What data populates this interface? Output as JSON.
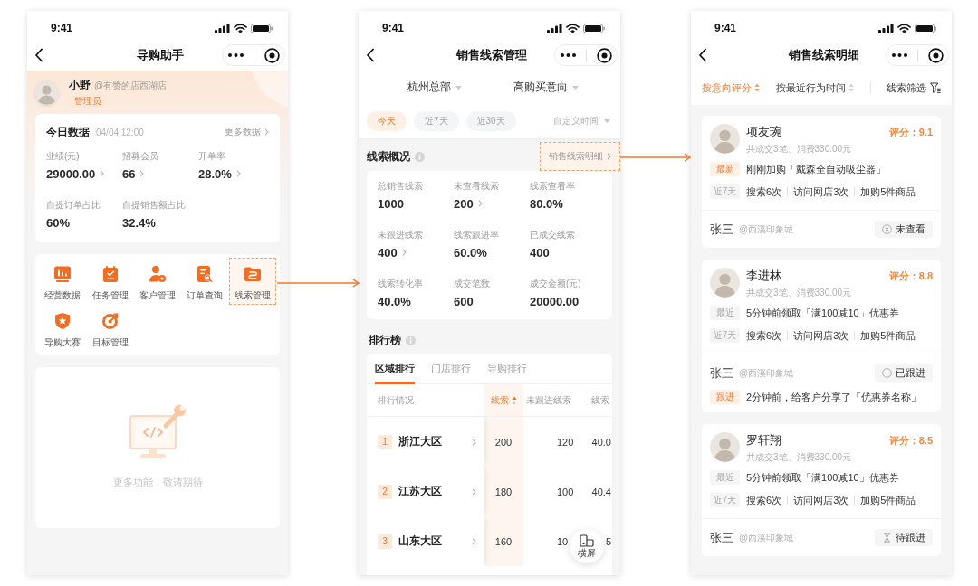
{
  "home_screen": {
    "status_time": "9:41",
    "title": "导购助手",
    "profile": {
      "name": "小野",
      "store": "@有赞的店西湖店",
      "role": "管理员"
    },
    "today": {
      "title": "今日数据",
      "time": "04/04 12:00",
      "more": "更多数据",
      "metrics": [
        {
          "label": "业绩(元)",
          "value": "29000.00",
          "link": true
        },
        {
          "label": "招募会员",
          "value": "66",
          "link": true
        },
        {
          "label": "开单率",
          "value": "28.0%",
          "link": true
        },
        {
          "label": "自提订单占比",
          "value": "60%",
          "link": false
        },
        {
          "label": "自提销售额占比",
          "value": "32.4%",
          "link": false
        }
      ]
    },
    "menu": [
      {
        "label": "经营数据",
        "highlighted": false
      },
      {
        "label": "任务管理",
        "highlighted": false
      },
      {
        "label": "客户管理",
        "highlighted": false
      },
      {
        "label": "订单查询",
        "highlighted": false
      },
      {
        "label": "线索管理",
        "highlighted": true
      },
      {
        "label": "导购大赛",
        "highlighted": false
      },
      {
        "label": "目标管理",
        "highlighted": false
      }
    ],
    "empty_state": {
      "text": "更多功能，敬请期待"
    }
  },
  "leads_screen": {
    "status_time": "9:41",
    "title": "销售线索管理",
    "dropdowns": [
      "杭州总部",
      "高购买意向"
    ],
    "date_chips": [
      {
        "label": "今天",
        "selected": true
      },
      {
        "label": "近7天",
        "selected": false
      },
      {
        "label": "近30天",
        "selected": false
      }
    ],
    "custom_time": "自定义时间",
    "overview": {
      "title": "线索概况",
      "detail_link": {
        "label": "销售线索明细",
        "highlighted": true
      },
      "metrics": [
        {
          "label": "总销售线索",
          "value": "1000",
          "link": false
        },
        {
          "label": "未查看线索",
          "value": "200",
          "link": true
        },
        {
          "label": "线索查看率",
          "value": "80.0%",
          "link": false
        },
        {
          "label": "未跟进线索",
          "value": "400",
          "link": true
        },
        {
          "label": "线索跟进率",
          "value": "60.0%",
          "link": false
        },
        {
          "label": "已成交线索",
          "value": "400",
          "link": false
        },
        {
          "label": "线索转化率",
          "value": "40.0%",
          "link": false
        },
        {
          "label": "成交笔数",
          "value": "600",
          "link": false
        },
        {
          "label": "成交金额(元)",
          "value": "20000.00",
          "link": false
        }
      ]
    },
    "ranking": {
      "title": "排行榜",
      "tabs": [
        {
          "label": "区域排行",
          "selected": true
        },
        {
          "label": "门店排行",
          "selected": false
        },
        {
          "label": "导购排行",
          "selected": false
        }
      ],
      "first_column": {
        "label": "排行情况"
      },
      "columns": [
        {
          "label": "线索",
          "selected": true,
          "sort_ascending": true
        },
        {
          "label": "未跟进线索",
          "selected": false
        },
        {
          "label": "线索",
          "selected": false
        }
      ],
      "rows": [
        {
          "rank": "1",
          "name": "浙江大区",
          "cells": [
            "200",
            "120",
            "40.0"
          ]
        },
        {
          "rank": "2",
          "name": "江苏大区",
          "cells": [
            "180",
            "100",
            "40.4"
          ]
        },
        {
          "rank": "3",
          "name": "山东大区",
          "cells": [
            "160",
            "10",
            "5"
          ]
        }
      ]
    },
    "rotate_button": {
      "label": "横屏"
    }
  },
  "lead_detail_screen": {
    "status_time": "9:41",
    "title": "销售线索明细",
    "sort_options": [
      {
        "label": "按意向评分",
        "selected": true
      },
      {
        "label": "按最近行为时间",
        "selected": false
      }
    ],
    "filter": {
      "label": "线索筛选"
    },
    "leads": [
      {
        "name": "项友琬",
        "score": "评分：9.1",
        "summary": "共成交3笔、消费330.00元",
        "activities": [
          {
            "tag": "最新",
            "kind": "accent",
            "items": [
              "刚刚加购「戴森全自动吸尘器」"
            ]
          },
          {
            "tag": "近7天",
            "kind": "muted",
            "items": [
              "搜索6次",
              "访问网店3次",
              "加购5件商品"
            ]
          }
        ],
        "owner": "张三",
        "store": "@西溪印象城",
        "status": {
          "label": "未查看",
          "kind": "unviewed"
        }
      },
      {
        "name": "李进林",
        "score": "评分：8.8",
        "summary": "共成交3笔、消费330.00元",
        "activities": [
          {
            "tag": "最近",
            "kind": "muted",
            "items": [
              "5分钟前领取「满100减10」优惠券"
            ]
          },
          {
            "tag": "近7天",
            "kind": "muted",
            "items": [
              "搜索6次",
              "访问网店3次",
              "加购5件商品"
            ]
          }
        ],
        "owner": "张三",
        "store": "@西溪印象城",
        "status": {
          "label": "已跟进",
          "kind": "followed"
        },
        "followups": [
          {
            "tag": "跟进",
            "kind": "accent",
            "items": [
              "2分钟前，给客户分享了「优惠券名称」"
            ]
          }
        ]
      },
      {
        "name": "罗轩翔",
        "score": "评分：8.5",
        "summary": "共成交3笔、消费330.00元",
        "activities": [
          {
            "tag": "最近",
            "kind": "muted",
            "items": [
              "5分钟前领取「满100减10」优惠券"
            ]
          },
          {
            "tag": "近7天",
            "kind": "muted",
            "items": [
              "搜索6次",
              "访问网店3次",
              "加购5件商品"
            ]
          }
        ],
        "owner": "张三",
        "store": "@西溪印象城",
        "status": {
          "label": "待跟进",
          "kind": "pending"
        }
      }
    ]
  }
}
